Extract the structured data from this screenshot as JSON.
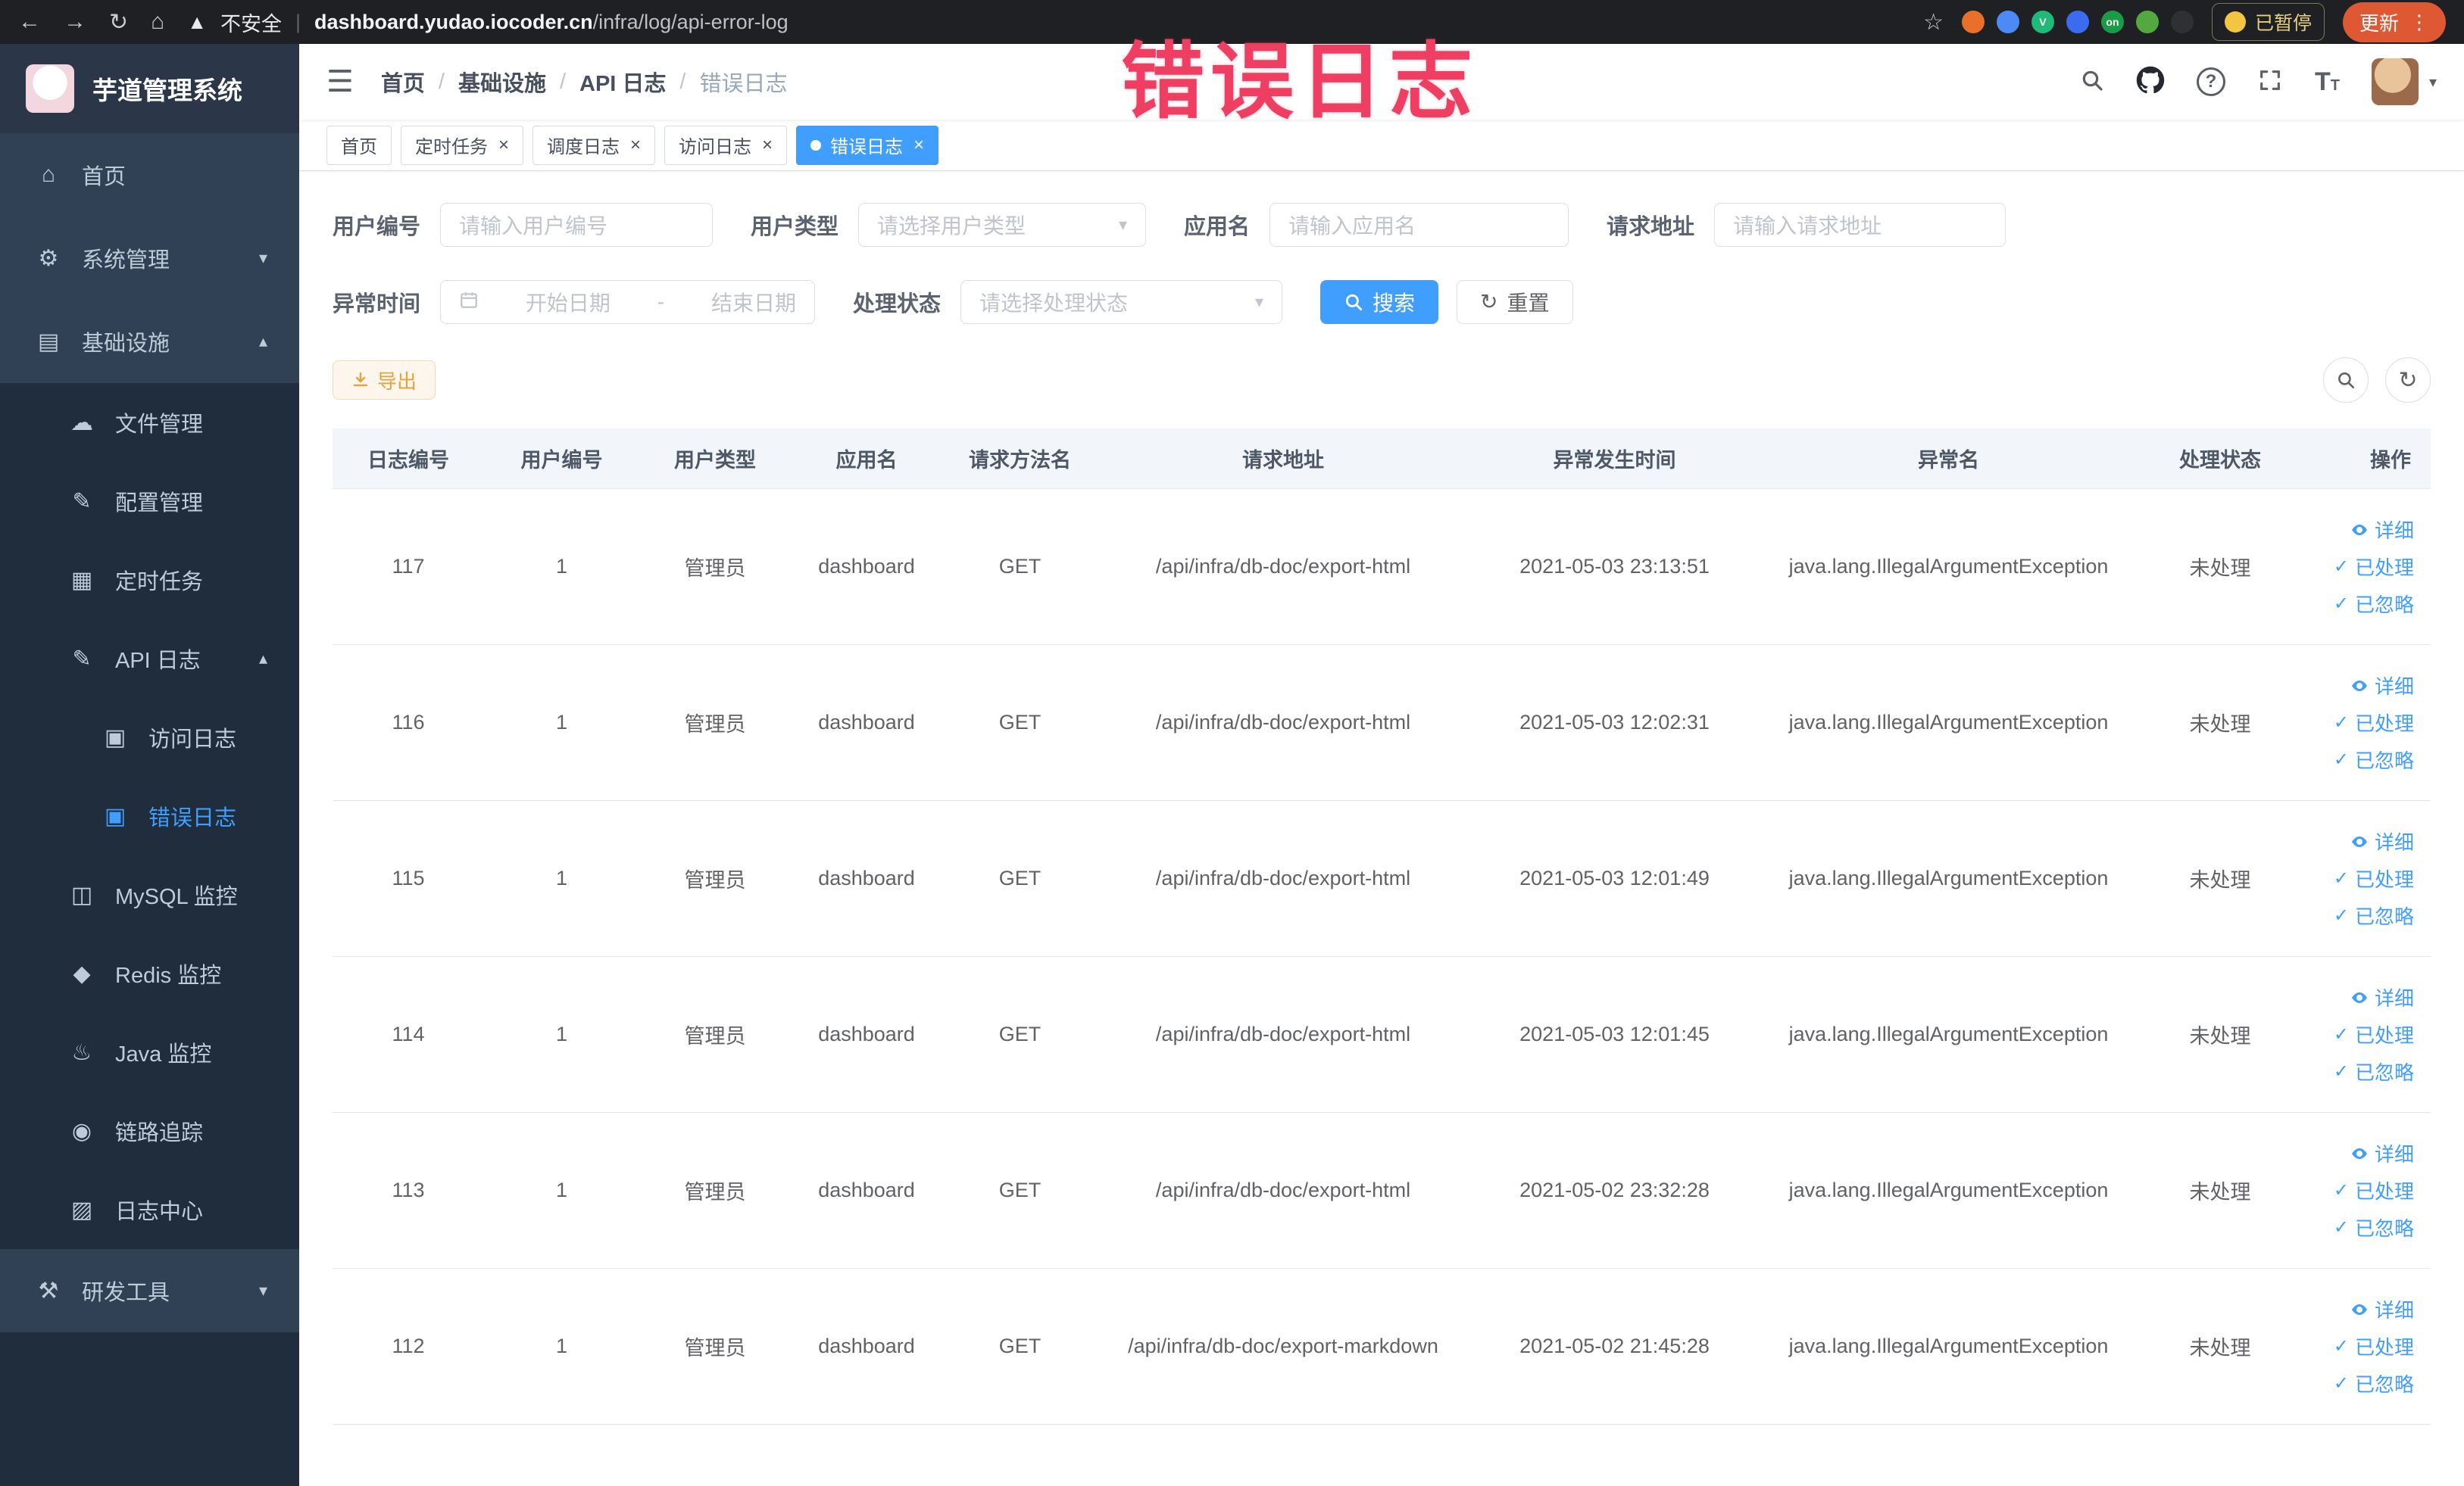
{
  "browser": {
    "security_warning": "不安全",
    "url_domain": "dashboard.yudao.iocoder.cn",
    "url_path": "/infra/log/api-error-log",
    "extensions": [
      {
        "name": "extension-icon-1",
        "color": "#e8702a",
        "label": ""
      },
      {
        "name": "extension-icon-2",
        "color": "#4c8bf5",
        "label": ""
      },
      {
        "name": "extension-icon-3",
        "color": "#1fb978",
        "label": "V"
      },
      {
        "name": "extension-icon-4",
        "color": "#3b6cf0",
        "label": ""
      },
      {
        "name": "extension-icon-5",
        "color": "#1a9c46",
        "label": "on"
      },
      {
        "name": "extension-icon-6",
        "color": "#53a93f",
        "label": ""
      },
      {
        "name": "extension-icon-7",
        "color": "#2f3033",
        "label": ""
      }
    ],
    "paused_badge": "已暂停",
    "update_label": "更新"
  },
  "annotation": {
    "title": "错误日志"
  },
  "sidebar": {
    "logo_title": "芋道管理系统",
    "menu": [
      {
        "key": "home",
        "label": "首页",
        "icon": "home-icon",
        "level": 1
      },
      {
        "key": "system",
        "label": "系统管理",
        "icon": "gear-icon",
        "level": 1,
        "chevron": "down"
      },
      {
        "key": "infrastructure",
        "label": "基础设施",
        "icon": "grid-icon",
        "level": 1,
        "chevron": "up"
      },
      {
        "key": "file",
        "label": "文件管理",
        "icon": "cloud-icon",
        "level": 2
      },
      {
        "key": "config",
        "label": "配置管理",
        "icon": "edit-icon",
        "level": 2
      },
      {
        "key": "job",
        "label": "定时任务",
        "icon": "list-icon",
        "level": 2
      },
      {
        "key": "api-log",
        "label": "API 日志",
        "icon": "log-icon",
        "level": 2,
        "chevron": "up"
      },
      {
        "key": "access-log",
        "label": "访问日志",
        "icon": "doc-icon",
        "level": 3
      },
      {
        "key": "error-log",
        "label": "错误日志",
        "icon": "doc-icon",
        "level": 3,
        "active": true
      },
      {
        "key": "mysql",
        "label": "MySQL 监控",
        "icon": "mysql-icon",
        "level": 2
      },
      {
        "key": "redis",
        "label": "Redis 监控",
        "icon": "redis-icon",
        "level": 2
      },
      {
        "key": "java",
        "label": "Java 监控",
        "icon": "java-icon",
        "level": 2
      },
      {
        "key": "tracer",
        "label": "链路追踪",
        "icon": "trace-icon",
        "level": 2
      },
      {
        "key": "log-center",
        "label": "日志中心",
        "icon": "log-center-icon",
        "level": 2
      },
      {
        "key": "dev-tools",
        "label": "研发工具",
        "icon": "tools-icon",
        "level": 1,
        "chevron": "down"
      }
    ]
  },
  "breadcrumb": [
    "首页",
    "基础设施",
    "API 日志",
    "错误日志"
  ],
  "tabs": [
    {
      "key": "home",
      "label": "首页",
      "closable": false,
      "active": false
    },
    {
      "key": "job",
      "label": "定时任务",
      "closable": true,
      "active": false
    },
    {
      "key": "job-log",
      "label": "调度日志",
      "closable": true,
      "active": false
    },
    {
      "key": "access-log",
      "label": "访问日志",
      "closable": true,
      "active": false
    },
    {
      "key": "error-log",
      "label": "错误日志",
      "closable": true,
      "active": true
    }
  ],
  "filters": {
    "user_id": {
      "label": "用户编号",
      "placeholder": "请输入用户编号"
    },
    "user_type": {
      "label": "用户类型",
      "placeholder": "请选择用户类型"
    },
    "app_name": {
      "label": "应用名",
      "placeholder": "请输入应用名"
    },
    "request_url": {
      "label": "请求地址",
      "placeholder": "请输入请求地址"
    },
    "exception_time": {
      "label": "异常时间",
      "start_placeholder": "开始日期",
      "separator": "-",
      "end_placeholder": "结束日期"
    },
    "process_status": {
      "label": "处理状态",
      "placeholder": "请选择处理状态"
    },
    "search_label": "搜索",
    "reset_label": "重置"
  },
  "toolbar": {
    "export_label": "导出"
  },
  "table": {
    "headers": [
      "日志编号",
      "用户编号",
      "用户类型",
      "应用名",
      "请求方法名",
      "请求地址",
      "异常发生时间",
      "异常名",
      "处理状态",
      "操作"
    ],
    "action_labels": {
      "detail": "详细",
      "processed": "已处理",
      "ignored": "已忽略"
    },
    "rows": [
      {
        "log_id": "117",
        "user_id": "1",
        "user_type": "管理员",
        "app_name": "dashboard",
        "method": "GET",
        "url": "/api/infra/db-doc/export-html",
        "time": "2021-05-03 23:13:51",
        "exception": "java.lang.IllegalArgumentException",
        "status": "未处理"
      },
      {
        "log_id": "116",
        "user_id": "1",
        "user_type": "管理员",
        "app_name": "dashboard",
        "method": "GET",
        "url": "/api/infra/db-doc/export-html",
        "time": "2021-05-03 12:02:31",
        "exception": "java.lang.IllegalArgumentException",
        "status": "未处理"
      },
      {
        "log_id": "115",
        "user_id": "1",
        "user_type": "管理员",
        "app_name": "dashboard",
        "method": "GET",
        "url": "/api/infra/db-doc/export-html",
        "time": "2021-05-03 12:01:49",
        "exception": "java.lang.IllegalArgumentException",
        "status": "未处理"
      },
      {
        "log_id": "114",
        "user_id": "1",
        "user_type": "管理员",
        "app_name": "dashboard",
        "method": "GET",
        "url": "/api/infra/db-doc/export-html",
        "time": "2021-05-03 12:01:45",
        "exception": "java.lang.IllegalArgumentException",
        "status": "未处理"
      },
      {
        "log_id": "113",
        "user_id": "1",
        "user_type": "管理员",
        "app_name": "dashboard",
        "method": "GET",
        "url": "/api/infra/db-doc/export-html",
        "time": "2021-05-02 23:32:28",
        "exception": "java.lang.IllegalArgumentException",
        "status": "未处理"
      },
      {
        "log_id": "112",
        "user_id": "1",
        "user_type": "管理员",
        "app_name": "dashboard",
        "method": "GET",
        "url": "/api/infra/db-doc/export-markdown",
        "time": "2021-05-02 21:45:28",
        "exception": "java.lang.IllegalArgumentException",
        "status": "未处理"
      }
    ]
  },
  "colors": {
    "accent": "#409EFF",
    "warning": "#E6A23C",
    "annotation_red": "#ee3f63",
    "sidebar_bg": "#304156",
    "submenu_bg": "#1f2d3d"
  }
}
